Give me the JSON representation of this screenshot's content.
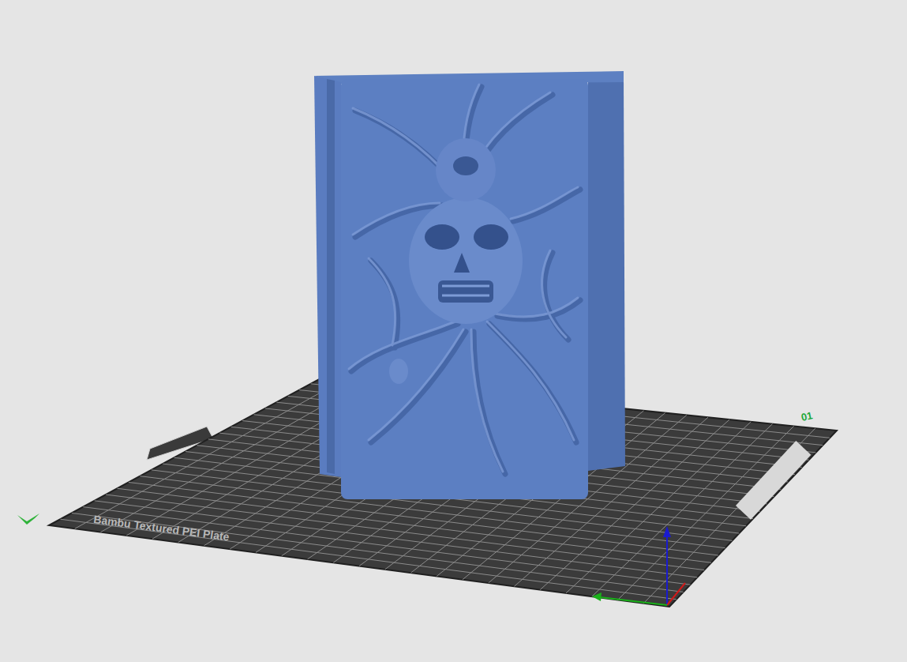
{
  "plate": {
    "label": "Bambu Textured PEI Plate",
    "number": "01"
  }
}
